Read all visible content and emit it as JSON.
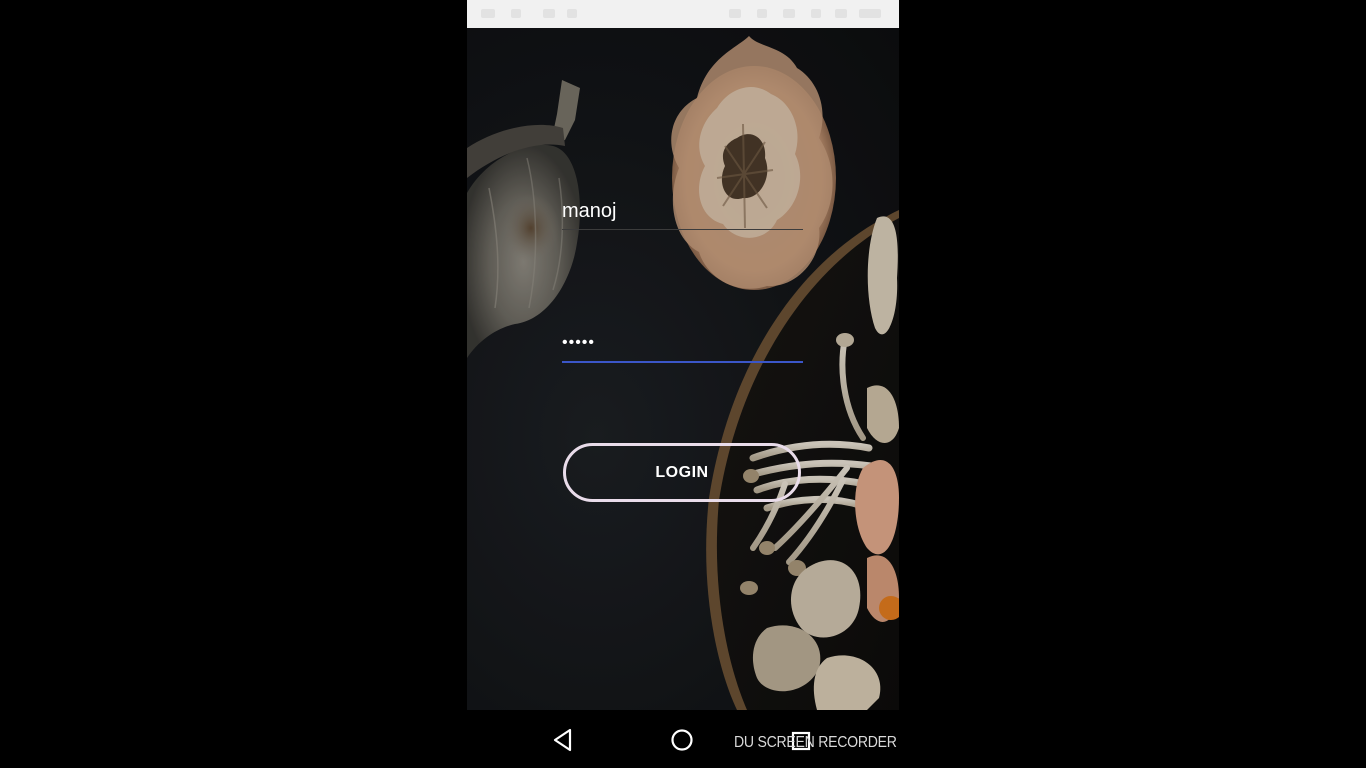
{
  "login_form": {
    "username_value": "manoj",
    "password_value": "manoj",
    "login_label": "LOGIN"
  },
  "navigation": {
    "back_icon": "back-triangle-icon",
    "home_icon": "home-circle-icon",
    "recents_icon": "recents-square-icon"
  },
  "overlay": {
    "watermark": "DU SCREEN RECORDER"
  },
  "colors": {
    "status_bar": "#f1f1f1",
    "screen_background": "#131518",
    "focused_underline": "#3b56c8",
    "button_border": "#e9dcea",
    "text": "#ffffff"
  }
}
